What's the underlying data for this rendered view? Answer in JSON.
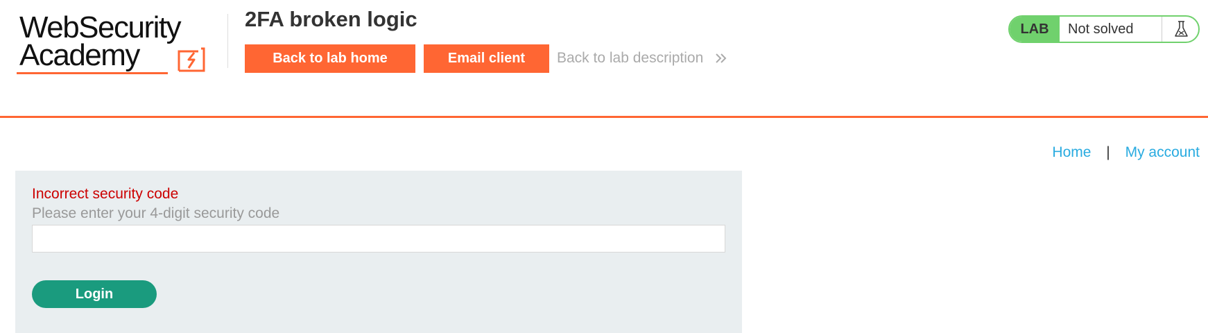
{
  "logo": {
    "line1": "WebSecurity",
    "line2": "Academy",
    "icon": "lightning-bolt-icon"
  },
  "header": {
    "lab_title": "2FA broken logic",
    "back_home_label": "Back to lab home",
    "email_client_label": "Email client",
    "back_description_label": "Back to lab description",
    "back_description_icon": "double-chevron-right-icon"
  },
  "lab_status": {
    "badge": "LAB",
    "state": "Not solved",
    "icon": "flask-icon",
    "badge_color": "#70d16d"
  },
  "nav": {
    "home": "Home",
    "separator": "|",
    "my_account": "My account"
  },
  "form": {
    "error": "Incorrect security code",
    "label": "Please enter your 4-digit security code",
    "input_value": "",
    "login_label": "Login"
  },
  "colors": {
    "accent": "#ff6633",
    "link": "#29abe0",
    "error": "#cc0000",
    "button_primary": "#1a9b7e",
    "panel_bg": "#e9eef0"
  }
}
